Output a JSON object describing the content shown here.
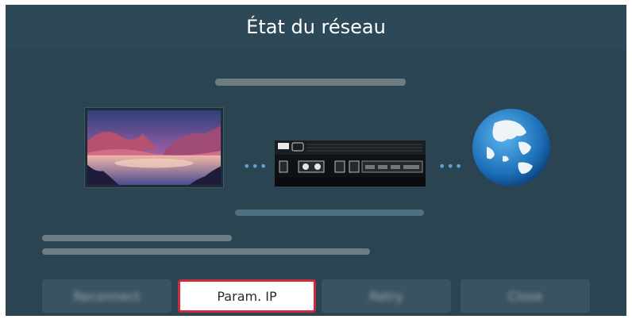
{
  "dialog": {
    "title": "État du réseau"
  },
  "buttons": [
    {
      "label": "Reconnect",
      "focused": false
    },
    {
      "label": "Param. IP",
      "focused": true
    },
    {
      "label": "Retry",
      "focused": false
    },
    {
      "label": "Close",
      "focused": false
    }
  ],
  "connection": {
    "dots_left": "•••",
    "dots_right": "•••"
  },
  "colors": {
    "background": "#2b4451",
    "title_bar": "#2d4958",
    "focus_border": "#cf2a3b",
    "dot": "#5fa3d6"
  },
  "icons": [
    "tv-icon",
    "one-connect-box-icon",
    "globe-icon"
  ]
}
